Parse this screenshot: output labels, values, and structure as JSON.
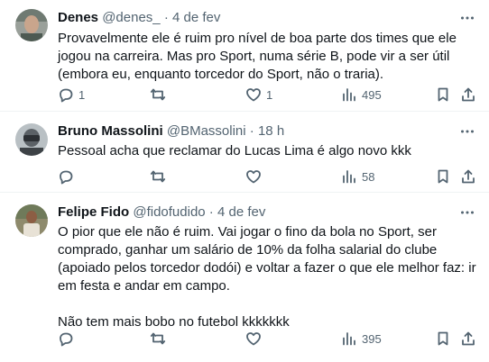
{
  "tweets": [
    {
      "name": "Denes",
      "handle": "@denes_",
      "time": "4 de fev",
      "text": "Provavelmente ele é ruim pro nível de boa parte dos times que ele jogou na carreira. Mas pro Sport, numa série B, pode vir a ser útil (embora eu, enquanto torcedor do Sport, não o traria).",
      "replies": "1",
      "retweets": "",
      "likes": "1",
      "views": "495"
    },
    {
      "name": "Bruno Massolini",
      "handle": "@BMassolini",
      "time": "18 h",
      "text": "Pessoal acha que reclamar do Lucas Lima é algo novo kkk",
      "replies": "",
      "retweets": "",
      "likes": "",
      "views": "58"
    },
    {
      "name": "Felipe Fido",
      "handle": "@fidofudido",
      "time": "4 de fev",
      "text": "O pior que ele não é ruim. Vai jogar o fino da bola no Sport, ser comprado, ganhar um salário de 10% da folha salarial do clube (apoiado pelos torcedor dodói) e voltar a fazer o que ele melhor faz: ir em festa e andar em campo.\n\nNão tem mais bobo no futebol kkkkkkk",
      "replies": "",
      "retweets": "",
      "likes": "",
      "views": "395"
    }
  ],
  "separator": "·",
  "icons": [
    "more-icon",
    "reply-icon",
    "retweet-icon",
    "like-icon",
    "views-icon",
    "bookmark-icon",
    "share-icon"
  ],
  "colors": {
    "text": "#0f1419",
    "secondary": "#536471",
    "divider": "#eff3f4"
  }
}
